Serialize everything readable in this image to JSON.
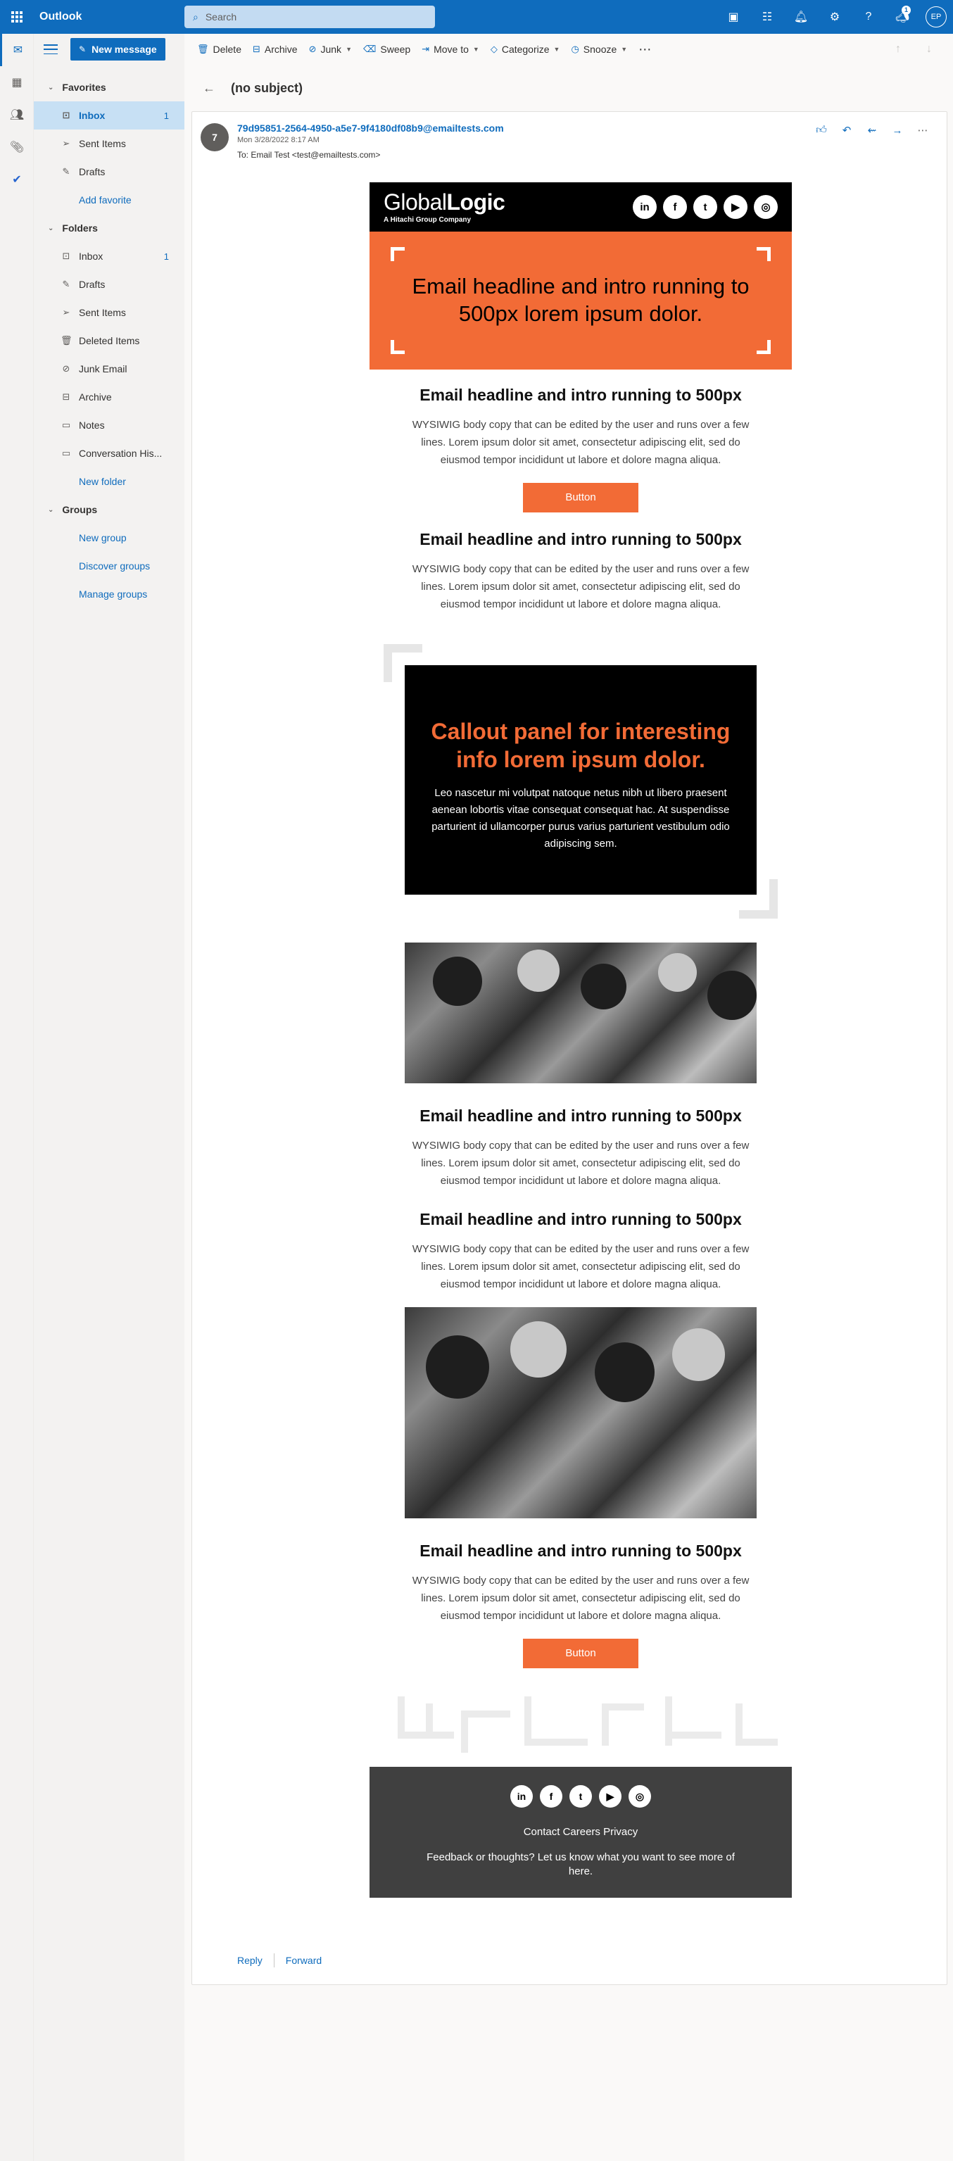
{
  "app": {
    "title": "Outlook",
    "search_placeholder": "Search",
    "avatar_initials": "EP",
    "notification_count": "1"
  },
  "toolbar": {
    "new_message": "New message",
    "delete": "Delete",
    "archive": "Archive",
    "junk": "Junk",
    "sweep": "Sweep",
    "move_to": "Move to",
    "categorize": "Categorize",
    "snooze": "Snooze"
  },
  "favorites": {
    "heading": "Favorites",
    "items": [
      {
        "label": "Inbox",
        "count": "1"
      },
      {
        "label": "Sent Items",
        "count": ""
      },
      {
        "label": "Drafts",
        "count": ""
      }
    ],
    "add_link": "Add favorite"
  },
  "folders": {
    "heading": "Folders",
    "items": [
      {
        "label": "Inbox",
        "count": "1"
      },
      {
        "label": "Drafts",
        "count": ""
      },
      {
        "label": "Sent Items",
        "count": ""
      },
      {
        "label": "Deleted Items",
        "count": ""
      },
      {
        "label": "Junk Email",
        "count": ""
      },
      {
        "label": "Archive",
        "count": ""
      },
      {
        "label": "Notes",
        "count": ""
      },
      {
        "label": "Conversation His...",
        "count": ""
      }
    ],
    "new_folder": "New folder"
  },
  "groups": {
    "heading": "Groups",
    "links": [
      "New group",
      "Discover groups",
      "Manage groups"
    ]
  },
  "message": {
    "subject": "(no subject)",
    "avatar": "7",
    "from": "79d95851-2564-4950-a5e7-9f4180df08b9@emailtests.com",
    "date": "Mon 3/28/2022 8:17 AM",
    "to": "To: Email Test <test@emailtests.com>",
    "reply": "Reply",
    "forward": "Forward"
  },
  "email": {
    "logo_regular": "Global",
    "logo_bold": "Logic",
    "logo_sub": "A Hitachi Group Company",
    "hero_text": "Email headline and intro running to 500px lorem ipsum dolor.",
    "headline": "Email headline and intro running to 500px",
    "body": "WYSIWIG body copy that can be edited by the user and runs over a few lines. Lorem ipsum dolor sit amet, consectetur adipiscing elit, sed do eiusmod tempor incididunt ut labore et dolore magna aliqua.",
    "button": "Button",
    "callout_title": "Callout panel for interesting info lorem ipsum dolor.",
    "callout_body": "Leo nascetur mi volutpat natoque netus nibh ut libero praesent aenean lobortis vitae consequat consequat hac. At suspendisse parturient id ullamcorper purus varius parturient vestibulum odio adipiscing sem.",
    "footer_links": "Contact Careers Privacy",
    "footer_feedback": "Feedback or thoughts? Let us know what you want to see more of here.",
    "social": [
      "in",
      "f",
      "t",
      "▶",
      "◎"
    ]
  },
  "colors": {
    "brand_blue": "#0f6cbd",
    "accent_orange": "#f26b36",
    "footer_grey": "#404040"
  }
}
